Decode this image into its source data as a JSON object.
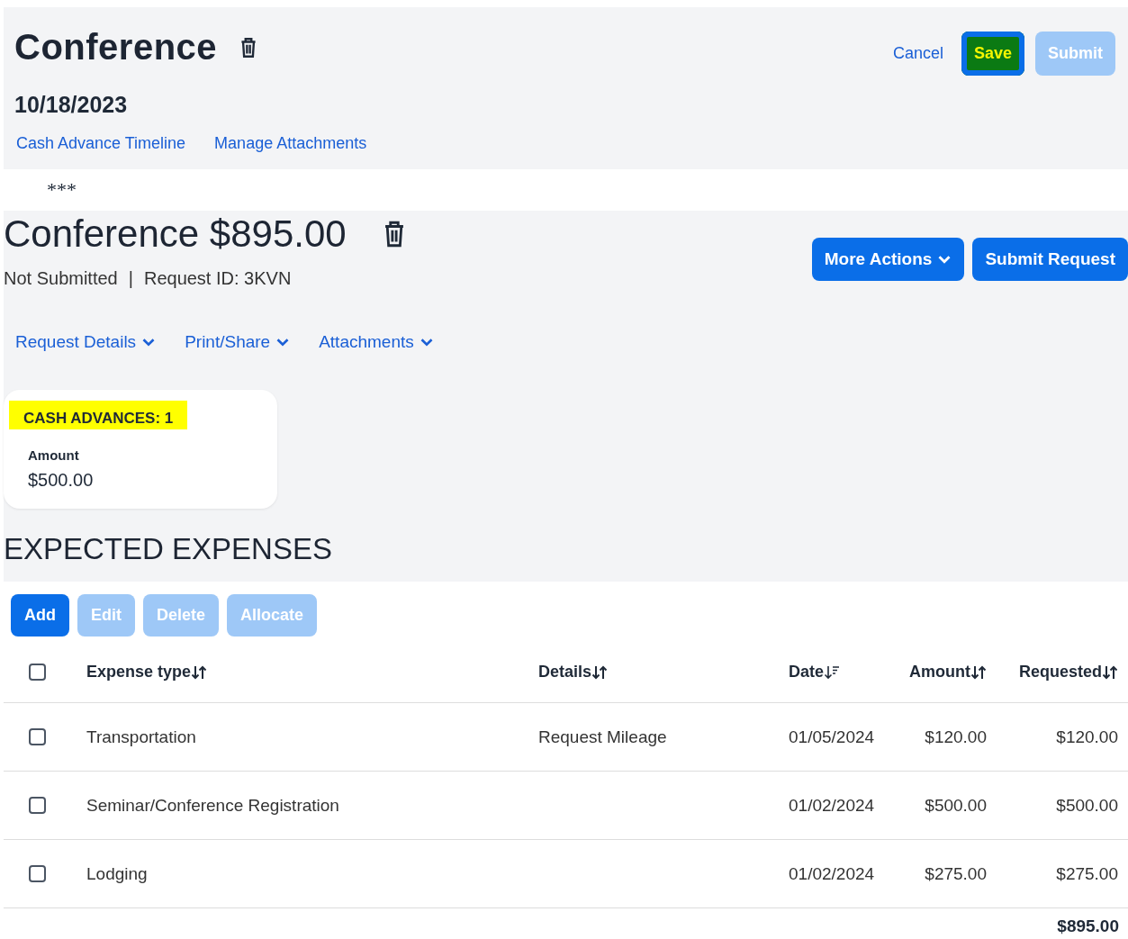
{
  "header": {
    "title": "Conference",
    "date": "10/18/2023",
    "actions": [
      {
        "label": "Cancel",
        "kind": "link",
        "disabled": false,
        "highlighted": false
      },
      {
        "label": "Save",
        "kind": "primary",
        "disabled": false,
        "highlighted": true
      },
      {
        "label": "Submit",
        "kind": "primary",
        "disabled": true,
        "highlighted": false
      }
    ],
    "links": [
      "Cash Advance Timeline",
      "Manage Attachments"
    ]
  },
  "separator": "***",
  "request": {
    "title": "Conference $895.00",
    "status": "Not Submitted",
    "divider": "|",
    "request_id": "Request ID: 3KVN",
    "buttons": [
      {
        "label": "More Actions",
        "dropdown": true
      },
      {
        "label": "Submit Request",
        "dropdown": false
      }
    ],
    "menus": [
      "Request Details",
      "Print/Share",
      "Attachments"
    ],
    "cash_advances": {
      "title": "CASH ADVANCES: 1",
      "highlighted": true,
      "label": "Amount",
      "value": "$500.00"
    }
  },
  "expenses": {
    "title": "EXPECTED EXPENSES",
    "buttons": [
      {
        "label": "Add",
        "disabled": false
      },
      {
        "label": "Edit",
        "disabled": true
      },
      {
        "label": "Delete",
        "disabled": true
      },
      {
        "label": "Allocate",
        "disabled": true
      }
    ],
    "select_all": {
      "checked": false
    },
    "columns": [
      {
        "label": "Expense type",
        "kind": "both"
      },
      {
        "label": "Details",
        "kind": "both"
      },
      {
        "label": "Date",
        "kind": "desc"
      },
      {
        "label": "Amount",
        "kind": "both"
      },
      {
        "label": "Requested",
        "kind": "both"
      }
    ],
    "rows": [
      {
        "checked": false,
        "cells": [
          "Transportation",
          "Request Mileage",
          "01/05/2024",
          "$120.00",
          "$120.00"
        ]
      },
      {
        "checked": false,
        "cells": [
          "Seminar/Conference Registration",
          "",
          "01/02/2024",
          "$500.00",
          "$500.00"
        ]
      },
      {
        "checked": false,
        "cells": [
          "Lodging",
          "",
          "01/02/2024",
          "$275.00",
          "$275.00"
        ]
      }
    ],
    "total": "$895.00"
  }
}
